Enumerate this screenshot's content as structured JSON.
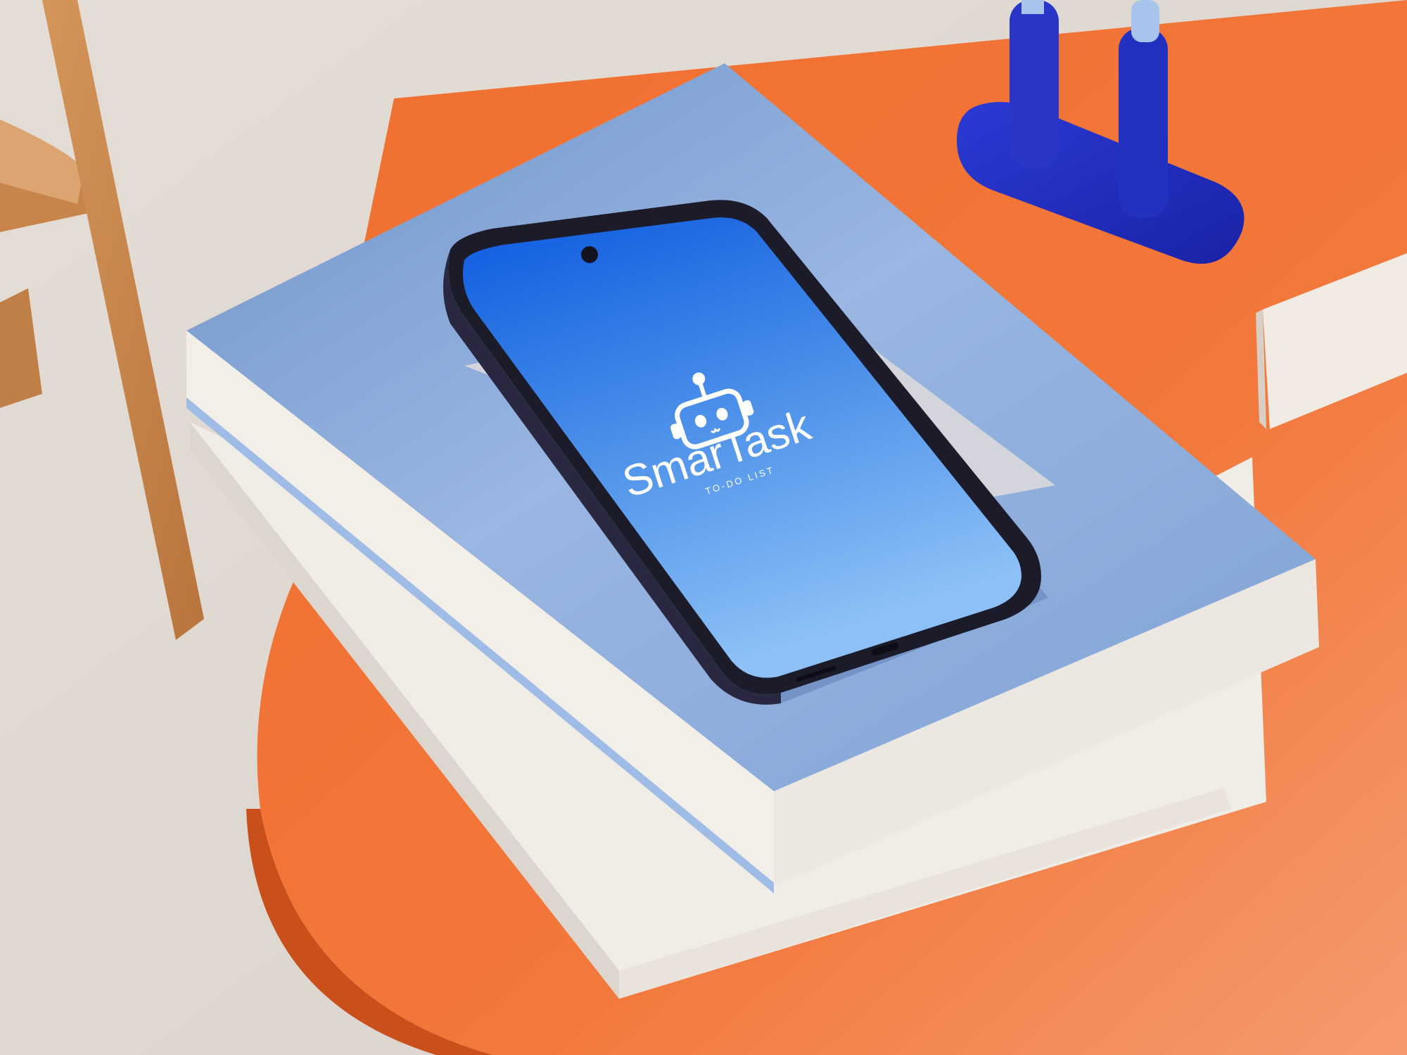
{
  "app": {
    "name_title": "SmarTask",
    "tagline": "TO-DO LIST",
    "logo_icon": "robot-icon"
  },
  "scene": {
    "description_kind": "product mockup photo"
  },
  "colors": {
    "screen_top": "#0d5fe0",
    "screen_bottom": "#89bdf5",
    "table": "#f06a2c",
    "book_cover": "#8fb0df",
    "phone_frame": "#1c1b2a",
    "candle_holder": "#2532c6",
    "floor": "#e7e1db"
  }
}
